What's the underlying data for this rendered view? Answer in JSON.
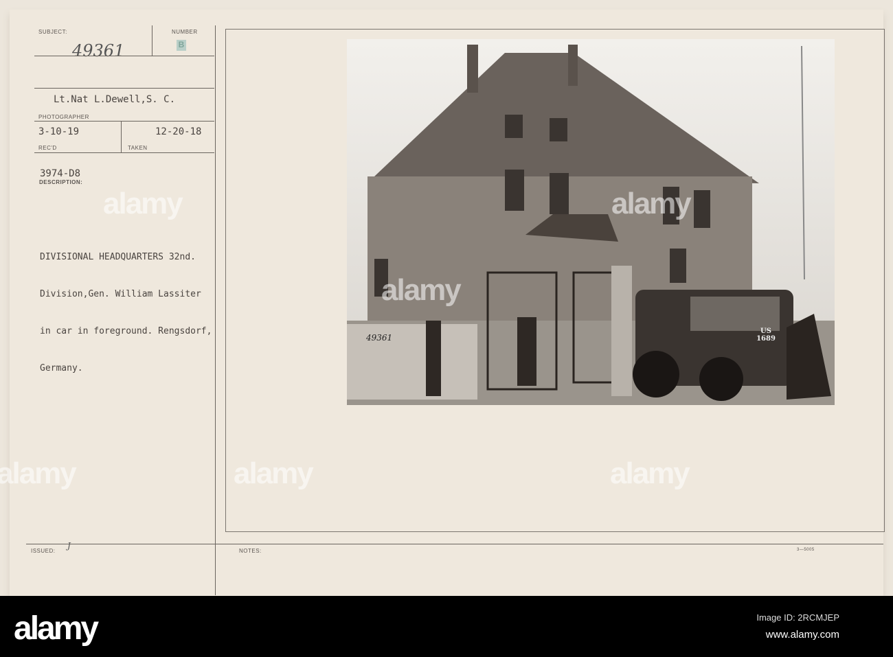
{
  "card": {
    "subject_label": "SUBJECT:",
    "subject_value": "49361",
    "number_label": "NUMBER",
    "number_value": "B",
    "photographer_value": "Lt.Nat L.Dewell,S. C.",
    "photographer_label": "PHOTOGRAPHER",
    "recd_value": "3-10-19",
    "recd_label": "REC'D",
    "taken_value": "12-20-18",
    "taken_label": "TAKEN",
    "ref_code": "3974-D8",
    "description_label": "DESCRIPTION:",
    "description_lines": [
      "DIVISIONAL HEADQUARTERS 32nd.",
      "Division,Gen. William Lassiter",
      "in car in foreground. Rengsdorf,",
      "Germany."
    ],
    "issued_label": "ISSUED:",
    "issued_value": "J",
    "notes_label": "NOTES:",
    "form_code": "3—5005"
  },
  "photo": {
    "handwritten_number": "49361",
    "car_plate": "US 1689"
  },
  "watermark": "alamy",
  "footer": {
    "logo": "alamy",
    "image_id": "Image ID: 2RCMJEP",
    "url": "www.alamy.com"
  }
}
